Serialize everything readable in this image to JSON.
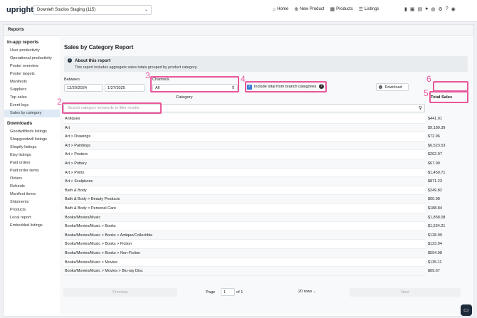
{
  "topbar": {
    "logo": "upright",
    "store": "Downleft Studios Staging (115)",
    "nav": [
      {
        "icon": "home-icon",
        "glyph": "⌂",
        "label": "Home"
      },
      {
        "icon": "plus-circle-icon",
        "glyph": "⊕",
        "label": "New Product"
      },
      {
        "icon": "products-icon",
        "glyph": "▦",
        "label": "Products"
      },
      {
        "icon": "listings-icon",
        "glyph": "☰",
        "label": "Listings"
      }
    ],
    "icons": [
      "trash-icon",
      "bag-icon",
      "calendar-icon",
      "user-icon",
      "globe-icon",
      "gear-icon",
      "question-icon",
      "user-circle-icon"
    ]
  },
  "frame": {
    "title": "Reports"
  },
  "sidebar": {
    "in_app_heading": "In-app reports",
    "in_app_items": [
      "User productivity",
      "Operational productivity",
      "Poster overview",
      "Poster targets",
      "Manifests",
      "Suppliers",
      "Top sales",
      "Event logs",
      "Sales by category"
    ],
    "active_item": "Sales by category",
    "downloads_heading": "Downloads",
    "download_items": [
      "Goodwillfinds listings",
      "Shopgoodwill listings",
      "Shopify listings",
      "Etsy listings",
      "Paid orders",
      "Paid order items",
      "Orders",
      "Refunds",
      "Manifest items",
      "Shipments",
      "Products",
      "Local report",
      "Embedded listings"
    ]
  },
  "report": {
    "title": "Sales by Category Report",
    "about_title": "About this report",
    "about_desc": "This report includes aggregate sales totals grouped by product category.",
    "between_label": "Between",
    "date_from": "12/29/2024",
    "date_to": "1/27/2025",
    "channels_label": "Channels",
    "channels_value": "All",
    "include_label": "Include total from branch categories",
    "download_label": "Download",
    "category_header": "Category",
    "total_header": "Total Sales",
    "search_placeholder": "Search category keywords to filter results"
  },
  "markers": [
    "2",
    "3",
    "4",
    "5",
    "6"
  ],
  "rows": [
    {
      "category": "Antiques",
      "total": "$441.01"
    },
    {
      "category": "Art",
      "total": "$9,189.39"
    },
    {
      "category": "Art > Drawings",
      "total": "$72.96"
    },
    {
      "category": "Art > Paintings",
      "total": "$6,523.53"
    },
    {
      "category": "Art > Posters",
      "total": "$202.97"
    },
    {
      "category": "Art > Pottery",
      "total": "$67.99"
    },
    {
      "category": "Art > Prints",
      "total": "$1,450.71"
    },
    {
      "category": "Art > Sculptures",
      "total": "$871.23"
    },
    {
      "category": "Bath & Body",
      "total": "$249.82"
    },
    {
      "category": "Bath & Body > Beauty Products",
      "total": "$60.98"
    },
    {
      "category": "Bath & Body > Personal Care",
      "total": "$188.84"
    },
    {
      "category": "Books/Movies/Music",
      "total": "$1,858.08"
    },
    {
      "category": "Books/Movies/Music > Books",
      "total": "$1,524.21"
    },
    {
      "category": "Books/Movies/Music > Books > Antique/Collectible",
      "total": "$128.99"
    },
    {
      "category": "Books/Movies/Music > Books > Fiction",
      "total": "$123.94"
    },
    {
      "category": "Books/Movies/Music > Books > Non-Fiction",
      "total": "$594.98"
    },
    {
      "category": "Books/Movies/Music > Movies",
      "total": "$135.11"
    },
    {
      "category": "Books/Movies/Music > Movies > Blu-ray Disc",
      "total": "$69.67"
    }
  ],
  "pager": {
    "previous": "Previous",
    "page_label": "Page",
    "page_value": "1",
    "of_label": "of 1",
    "rows_value": "20 rows",
    "next": "Next"
  }
}
